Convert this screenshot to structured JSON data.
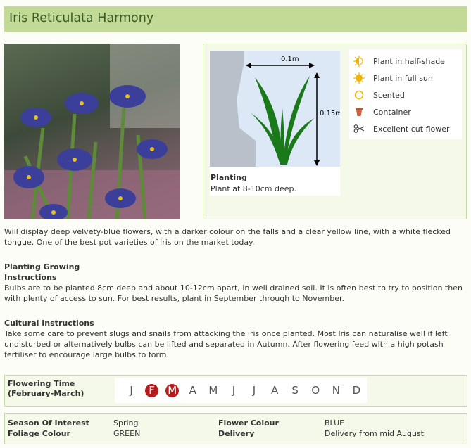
{
  "title": "Iris Reticulata Harmony",
  "diagram": {
    "width_label": "0.1m",
    "height_label": "0.15m",
    "planting_label": "Planting",
    "planting_text": "Plant at 8-10cm deep."
  },
  "attributes": [
    {
      "icon": "half-shade-icon",
      "label": "Plant in half-shade"
    },
    {
      "icon": "full-sun-icon",
      "label": "Plant in full sun"
    },
    {
      "icon": "scented-icon",
      "label": "Scented"
    },
    {
      "icon": "container-icon",
      "label": "Container"
    },
    {
      "icon": "scissors-icon",
      "label": "Excellent cut flower"
    }
  ],
  "description": "Will display deep velvety-blue flowers, with a darker colour on the falls and a clear yellow line, with a white flecked tongue. One of the best pot varieties of iris on the market today.",
  "planting": {
    "heading_line1": "Planting Growing",
    "heading_line2": "Instructions",
    "text": "Bulbs are to be planted 8cm deep and about 10-12cm apart, in well drained soil. It is often best to try to position then with plenty of access to sun. For best results, plant in September through to November."
  },
  "cultural": {
    "heading": "Cultural Instructions",
    "text": "Take some care to prevent slugs and snails from attacking the iris once planted. Most Iris can naturalise well if left undisturbed or alternatively bulbs can be lifted and separated in Autumn. After flowering feed with a high potash fertiliser to encourage large bulbs to form."
  },
  "flowering": {
    "label_line1": "Flowering Time",
    "label_line2": "(February-March)",
    "months": [
      {
        "letter": "J",
        "active": false
      },
      {
        "letter": "F",
        "active": true
      },
      {
        "letter": "M",
        "active": true
      },
      {
        "letter": "A",
        "active": false
      },
      {
        "letter": "M",
        "active": false
      },
      {
        "letter": "J",
        "active": false
      },
      {
        "letter": "J",
        "active": false
      },
      {
        "letter": "A",
        "active": false
      },
      {
        "letter": "S",
        "active": false
      },
      {
        "letter": "O",
        "active": false
      },
      {
        "letter": "N",
        "active": false
      },
      {
        "letter": "D",
        "active": false
      }
    ]
  },
  "details": {
    "season_key": "Season Of Interest",
    "season_val": "Spring",
    "foliage_key": "Foliage Colour",
    "foliage_val": "GREEN",
    "flower_key": "Flower Colour",
    "flower_val": "BLUE",
    "delivery_key": "Delivery",
    "delivery_val": "Delivery from mid August"
  },
  "colors": {
    "title_bar": "#c3da96",
    "title_text": "#3b5d24",
    "box_border": "#c4d9a3",
    "active_month": "#b41c1c",
    "leaf": "#1a7a1a"
  }
}
